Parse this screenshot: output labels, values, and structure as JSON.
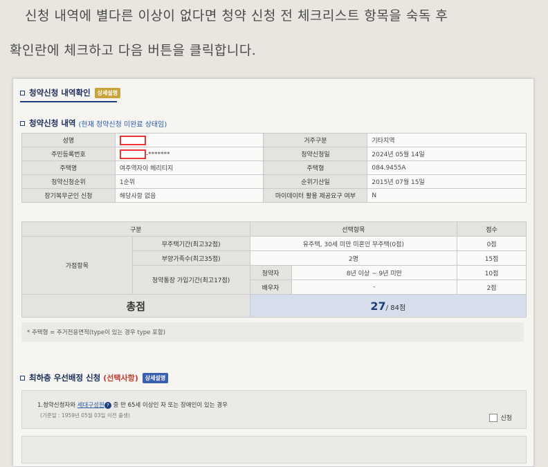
{
  "guide": {
    "line1": "신청 내역에 별다른 이상이 없다면 청약 신청 전 체크리스트 항목을 숙독 후",
    "line2": "확인란에 체크하고 다음 버튼을 클릭합니다."
  },
  "section_confirm": {
    "title": "청약신청 내역확인",
    "badge": "상세설명"
  },
  "section_detail": {
    "title": "청약신청 내역",
    "subtitle": "(현재 청약신청 미완료 상태임)"
  },
  "detail_rows": [
    {
      "l1": "성명",
      "v1": "",
      "l2": "거주구분",
      "v2": "기타지역"
    },
    {
      "l1": "주민등록번호",
      "v1": "-*******",
      "l2": "청약신청일",
      "v2": "2024년 05월 14일"
    },
    {
      "l1": "주택명",
      "v1": "여주역자이 헤리티지",
      "l2": "주택형",
      "v2": "084.9455A"
    },
    {
      "l1": "청약신청순위",
      "v1": "1순위",
      "l2": "순위기산일",
      "v2": "2015년 07월 15일"
    },
    {
      "l1": "장기복무군인 신청",
      "v1": "해당사항 없음",
      "l2": "마이데이터 활용 제공요구 여부",
      "v2": "N"
    }
  ],
  "score": {
    "h_category": "구분",
    "h_selection": "선택항목",
    "h_points": "점수",
    "group": "가점항목",
    "rows": [
      {
        "item": "무주택기간(최고32점)",
        "selection": "유주택, 30세 미만 미혼인 무주택(0점)",
        "points": "0점"
      },
      {
        "item": "부양가족수(최고35점)",
        "selection": "2명",
        "points": "15점"
      },
      {
        "item": "청약통장 가입기간(최고17점)",
        "sub": "청약자",
        "selection": "8년 이상 ~ 9년 미만",
        "points": "10점"
      },
      {
        "sub": "배우자",
        "selection": "-",
        "points": "2점"
      }
    ],
    "total_label": "총점",
    "total_value": "27",
    "total_max": "/ 84점"
  },
  "note": "* 주택형 = 주거전용면적(type이 있는 경우 type 포함)",
  "section_priority": {
    "title": "최하층 우선배정 신청",
    "subtitle": "(선택사항)",
    "badge": "상세설명"
  },
  "priority": {
    "line_pre": "1.청약신청자와 ",
    "line_link": "세대구성원",
    "line_post": " 중 만 65세 이상인 자 또는 장애인이 있는 경우",
    "subline": "(기준일 : 1959년 05월 03일 이전 출생)",
    "checkbox_label": "신청"
  }
}
